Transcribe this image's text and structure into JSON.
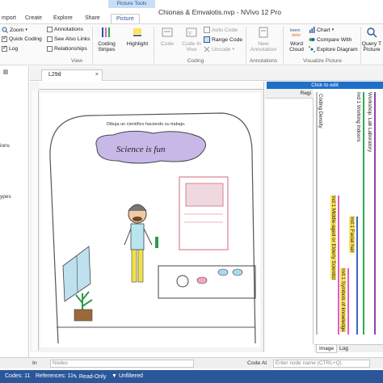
{
  "window": {
    "contextual_tab_group": "Picture Tools",
    "title": "Chionas & Emvalotis.nvp - NVivo 12 Pro"
  },
  "ribbon_tabs": [
    "mport",
    "Create",
    "Explore",
    "Share",
    "Picture"
  ],
  "ribbon": {
    "zoom": "Zoom",
    "quick_coding": "Quick Coding",
    "log": "Log",
    "annotations": "Annotations",
    "see_also_links": "See Also Links",
    "relationships": "Relationships",
    "view_group": "View",
    "coding_stripes": "Coding Stripes",
    "highlight": "Highlight",
    "code": "Code",
    "code_in_vivo": "Code In Vivo",
    "auto_code": "Auto Code",
    "range_code": "Range Code",
    "uncode": "Uncode",
    "coding_group": "Coding",
    "new_annotation": "New Annotation",
    "annotations_group": "Annotations",
    "word_cloud": "Word Cloud",
    "chart": "Chart",
    "compare_with": "Compare With",
    "explore_diagram": "Explore Diagram",
    "visualize_group": "Visualize Picture",
    "query_this_picture": "Query T Picture"
  },
  "left_nav": [
    "ions",
    "ypes"
  ],
  "doc_tab": {
    "label": "L29d",
    "close": "×"
  },
  "click_to_edit": "Click to edit",
  "drawing": {
    "caption": "Dibuja un científico haciendo su trabajo.",
    "cloud_text": "Science is fun"
  },
  "region_header": "Regi",
  "coding_stripes": {
    "coding_density": "Coding Density",
    "labels": [
      "Ind:1 Working Indoors",
      "Workshop: Lab Laboratory",
      "Ind:1 Middle-aged or Elderly Scientist",
      "Ind:1 Facial hair",
      "Ind:1 Symbols of knowledge"
    ]
  },
  "bottom_tabs": [
    "Image",
    "Log"
  ],
  "find_bar": {
    "in_label": "In",
    "nodes_field": "Nodes",
    "code_at_label": "Code At",
    "code_at_placeholder": "Enter node name (CTRL+Q)"
  },
  "status_bar": {
    "codes": "Codes: 11",
    "references": "References: 11",
    "read_only": "Read-Only",
    "unfiltered": "Unfiltered"
  },
  "colors": {
    "accent": "#2b579a",
    "click_bar": "#1f6fc8",
    "stripe_green": "#2fa84f",
    "stripe_purple": "#8e44ad",
    "stripe_pink": "#e05cc5",
    "stripe_blue": "#3b66c4",
    "highlight_yellow": "#ffe25a"
  }
}
